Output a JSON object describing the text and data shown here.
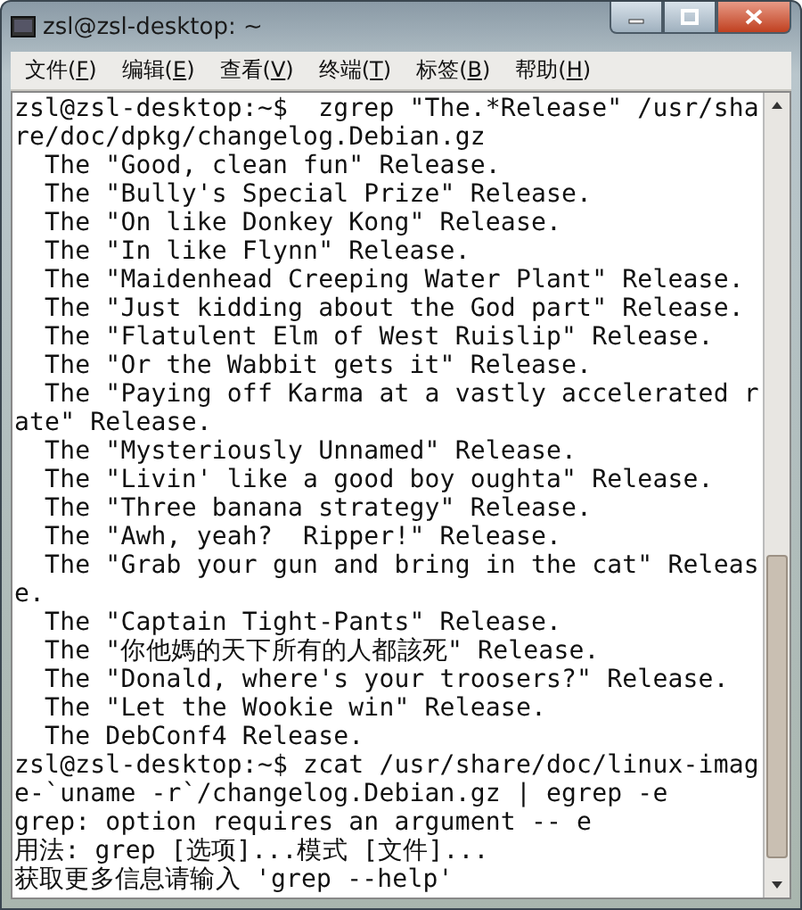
{
  "window": {
    "title": "zsl@zsl-desktop: ~"
  },
  "menu": [
    {
      "before": "文件(",
      "key": "F",
      "after": ")"
    },
    {
      "before": "编辑(",
      "key": "E",
      "after": ")"
    },
    {
      "before": "查看(",
      "key": "V",
      "after": ")"
    },
    {
      "before": "终端(",
      "key": "T",
      "after": ")"
    },
    {
      "before": "标签(",
      "key": "B",
      "after": ")"
    },
    {
      "before": "帮助(",
      "key": "H",
      "after": ")"
    }
  ],
  "terminal": {
    "lines": [
      "zsl@zsl-desktop:~$  zgrep \"The.*Release\" /usr/sha",
      "re/doc/dpkg/changelog.Debian.gz",
      "  The \"Good, clean fun\" Release.",
      "  The \"Bully's Special Prize\" Release.",
      "  The \"On like Donkey Kong\" Release.",
      "  The \"In like Flynn\" Release.",
      "  The \"Maidenhead Creeping Water Plant\" Release.",
      "  The \"Just kidding about the God part\" Release.",
      "  The \"Flatulent Elm of West Ruislip\" Release.",
      "  The \"Or the Wabbit gets it\" Release.",
      "  The \"Paying off Karma at a vastly accelerated r",
      "ate\" Release.",
      "  The \"Mysteriously Unnamed\" Release.",
      "  The \"Livin' like a good boy oughta\" Release.",
      "  The \"Three banana strategy\" Release.",
      "  The \"Awh, yeah?  Ripper!\" Release.",
      "  The \"Grab your gun and bring in the cat\" Releas",
      "e.",
      "  The \"Captain Tight-Pants\" Release.",
      "  The \"你他媽的天下所有的人都該死\" Release.",
      "  The \"Donald, where's your troosers?\" Release.",
      "  The \"Let the Wookie win\" Release.",
      "  The DebConf4 Release.",
      "zsl@zsl-desktop:~$ zcat /usr/share/doc/linux-imag",
      "e-`uname -r`/changelog.Debian.gz | egrep -e",
      "grep: option requires an argument -- e",
      "用法: grep [选项]...模式 [文件]...",
      "获取更多信息请输入 'grep --help'"
    ]
  }
}
